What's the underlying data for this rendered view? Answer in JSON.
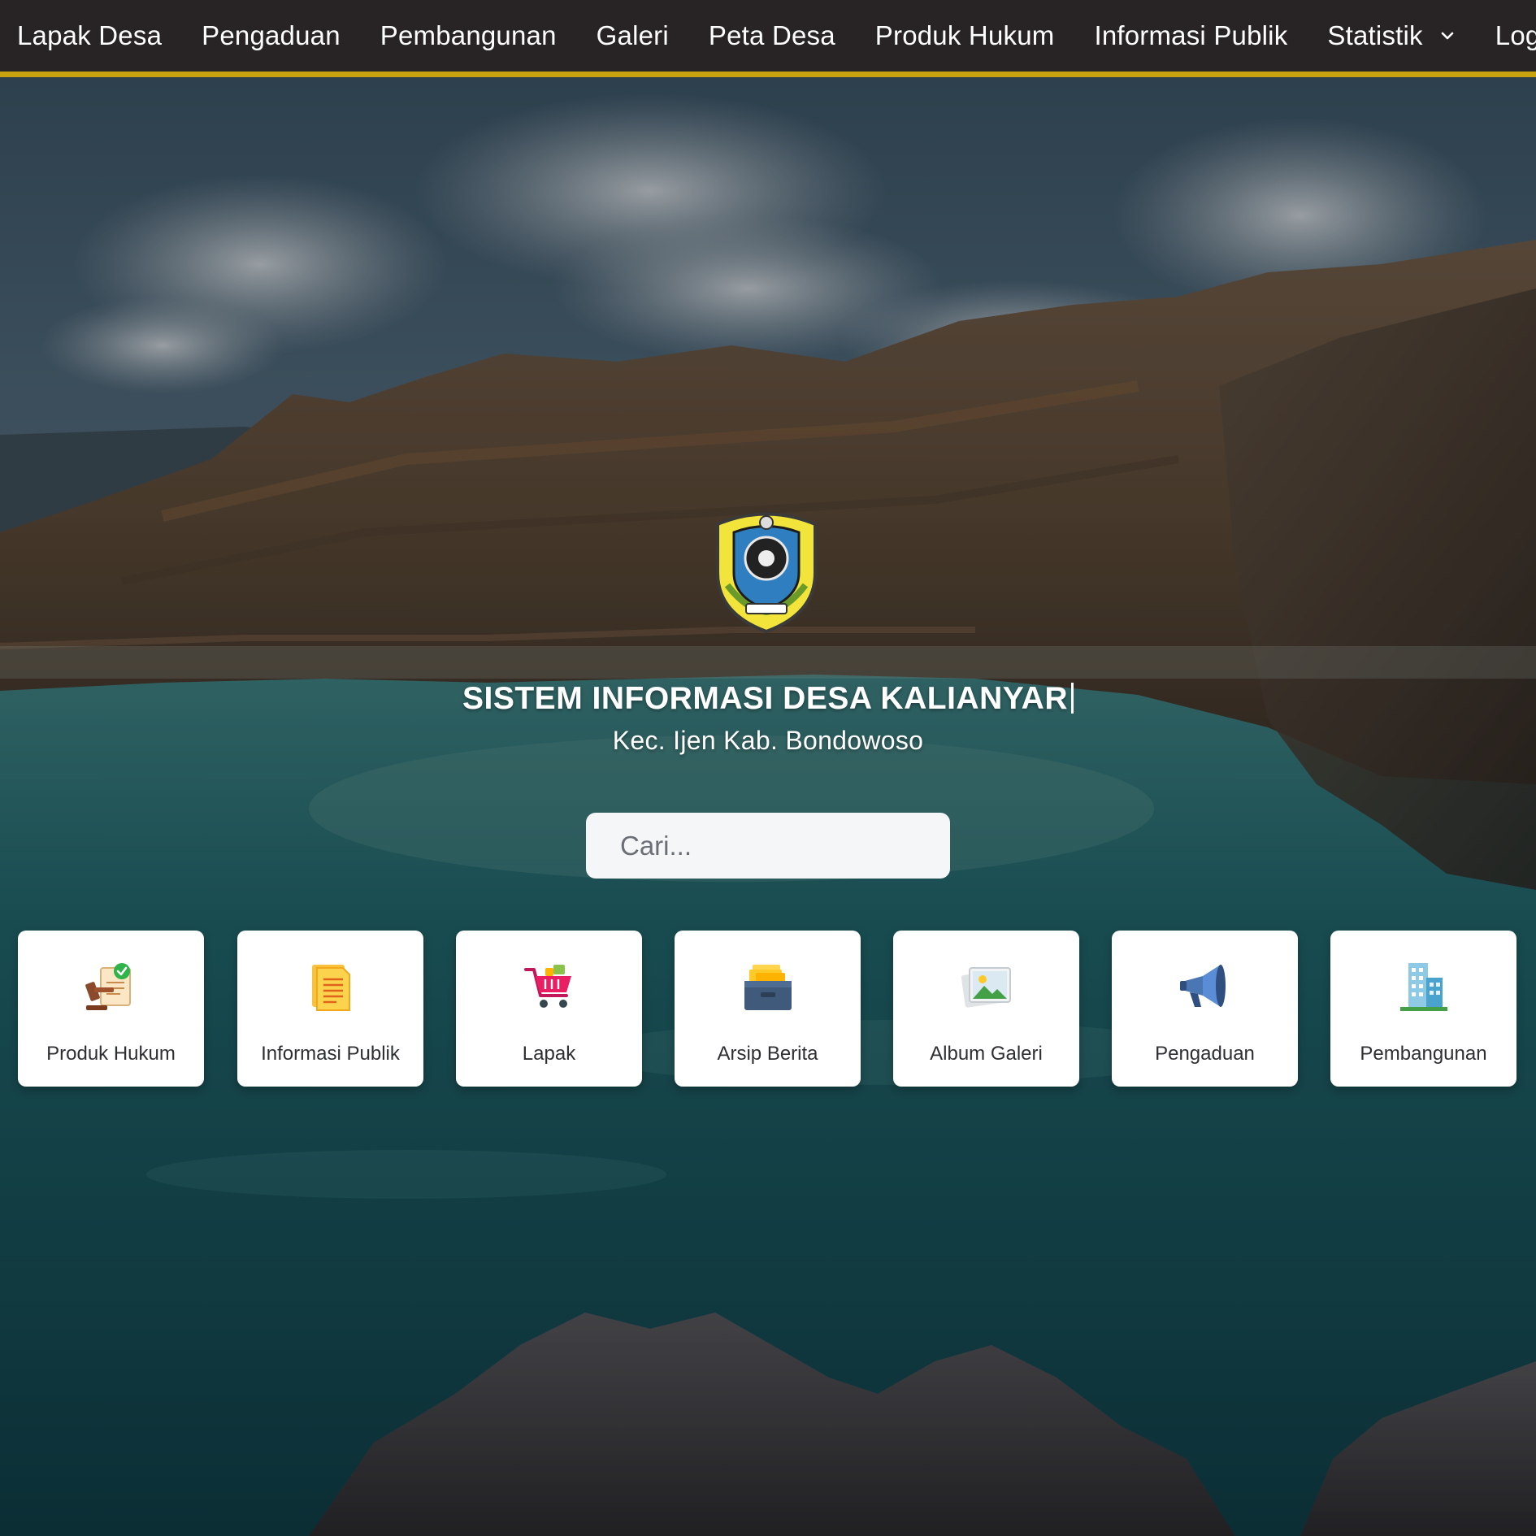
{
  "nav": {
    "items": [
      {
        "label": "Lapak Desa"
      },
      {
        "label": "Pengaduan"
      },
      {
        "label": "Pembangunan"
      },
      {
        "label": "Galeri"
      },
      {
        "label": "Peta Desa"
      },
      {
        "label": "Produk Hukum"
      },
      {
        "label": "Informasi Publik"
      },
      {
        "label": "Statistik",
        "icon": "chevron-down-icon"
      },
      {
        "label": "Log"
      }
    ]
  },
  "hero": {
    "title": "SISTEM INFORMASI DESA KALIANYAR",
    "subtitle": "Kec. Ijen Kab. Bondowoso",
    "emblem_icon": "regency-emblem"
  },
  "search": {
    "placeholder": "Cari...",
    "value": "",
    "icon": "search-icon"
  },
  "quick_menu": [
    {
      "label": "Produk Hukum",
      "icon": "gavel-document-icon"
    },
    {
      "label": "Informasi Publik",
      "icon": "document-icon"
    },
    {
      "label": "Lapak",
      "icon": "shopping-cart-icon"
    },
    {
      "label": "Arsip Berita",
      "icon": "archive-box-icon"
    },
    {
      "label": "Album Galeri",
      "icon": "image-gallery-icon"
    },
    {
      "label": "Pengaduan",
      "icon": "megaphone-icon"
    },
    {
      "label": "Pembangunan",
      "icon": "building-icon"
    }
  ],
  "colors": {
    "navbar_bg": "#282425",
    "navbar_accent": "#c9a20f",
    "card_bg": "#ffffff",
    "search_bg": "#f4f6f8"
  }
}
